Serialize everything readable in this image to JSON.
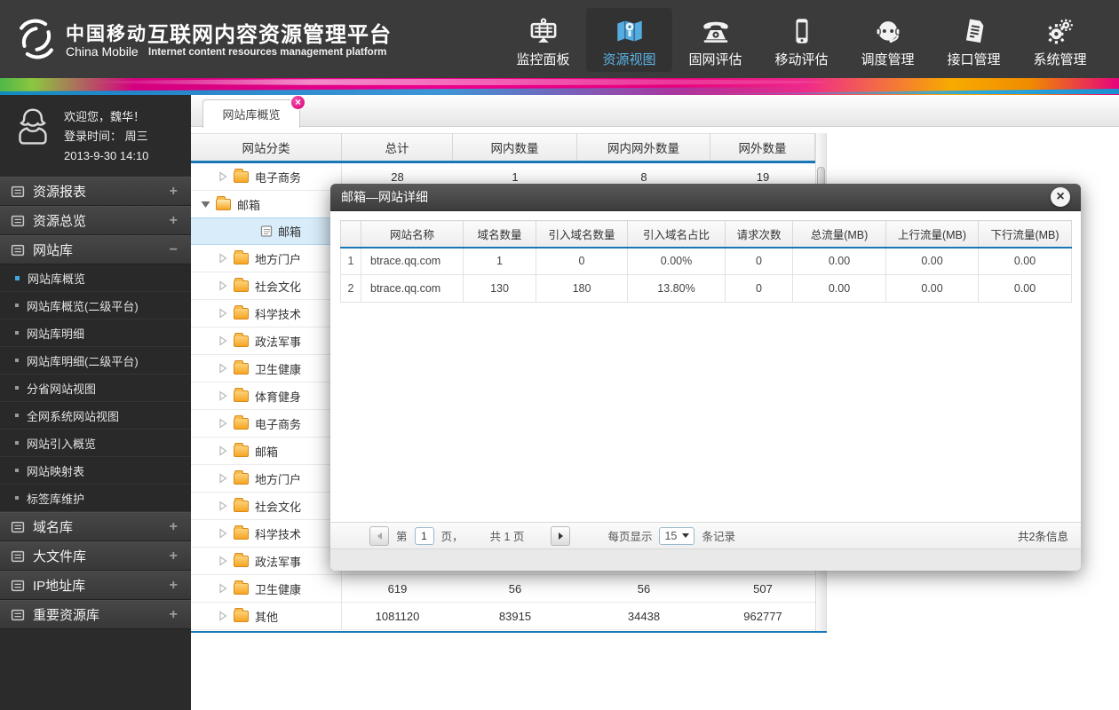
{
  "header": {
    "brand": {
      "cn": "中国移动",
      "en": "China Mobile"
    },
    "title_cn": "互联网内容资源管理平台",
    "title_en": "Internet content resources management platform",
    "nav": [
      {
        "label": "监控面板",
        "icon": "dashboard-icon",
        "active": false
      },
      {
        "label": "资源视图",
        "icon": "map-icon",
        "active": true
      },
      {
        "label": "固网评估",
        "icon": "phone-icon",
        "active": false
      },
      {
        "label": "移动评估",
        "icon": "mobile-icon",
        "active": false
      },
      {
        "label": "调度管理",
        "icon": "headset-icon",
        "active": false
      },
      {
        "label": "接口管理",
        "icon": "interface-doc-icon",
        "active": false
      },
      {
        "label": "系统管理",
        "icon": "gears-icon",
        "active": false
      }
    ],
    "accent_color": "#5db3e6"
  },
  "sidebar": {
    "user": {
      "welcome": "欢迎您，魏华！",
      "login_line": "登录时间： 周三",
      "login_time": "2013-9-30  14:10"
    },
    "menus": [
      {
        "label": "资源报表",
        "toggle": "+",
        "children": []
      },
      {
        "label": "资源总览",
        "toggle": "+",
        "children": []
      },
      {
        "label": "网站库",
        "toggle": "−",
        "children": [
          {
            "label": "网站库概览",
            "active": true
          },
          {
            "label": "网站库概览(二级平台)",
            "active": false
          },
          {
            "label": "网站库明细",
            "active": false
          },
          {
            "label": "网站库明细(二级平台)",
            "active": false
          },
          {
            "label": "分省网站视图",
            "active": false
          },
          {
            "label": "全网系统网站视图",
            "active": false
          },
          {
            "label": "网站引入概览",
            "active": false
          },
          {
            "label": "网站映射表",
            "active": false
          },
          {
            "label": "标签库维护",
            "active": false
          }
        ]
      },
      {
        "label": "域名库",
        "toggle": "+",
        "children": []
      },
      {
        "label": "大文件库",
        "toggle": "+",
        "children": []
      },
      {
        "label": "IP地址库",
        "toggle": "+",
        "children": []
      },
      {
        "label": "重要资源库",
        "toggle": "+",
        "children": []
      }
    ]
  },
  "tab": {
    "label": "网站库概览"
  },
  "main_table": {
    "columns": [
      "网站分类",
      "总计",
      "网内数量",
      "网内网外数量",
      "网外数量"
    ],
    "header_accent": "#1878b7",
    "rows": [
      {
        "label": "电子商务",
        "node": "collapsed",
        "selected": false,
        "values": [
          "28",
          "1",
          "8",
          "19"
        ]
      },
      {
        "label": "邮箱",
        "node": "expanded",
        "selected": false,
        "values": [
          "",
          "",
          "",
          ""
        ]
      },
      {
        "label": "邮箱",
        "node": "leaf",
        "selected": true,
        "values": [
          "",
          "",
          "",
          ""
        ]
      },
      {
        "label": "地方门户",
        "node": "collapsed",
        "selected": false,
        "values": [
          "",
          "",
          "",
          ""
        ]
      },
      {
        "label": "社会文化",
        "node": "collapsed",
        "selected": false,
        "values": [
          "",
          "",
          "",
          ""
        ]
      },
      {
        "label": "科学技术",
        "node": "collapsed",
        "selected": false,
        "values": [
          "",
          "",
          "",
          ""
        ]
      },
      {
        "label": "政法军事",
        "node": "collapsed",
        "selected": false,
        "values": [
          "",
          "",
          "",
          ""
        ]
      },
      {
        "label": "卫生健康",
        "node": "collapsed",
        "selected": false,
        "values": [
          "",
          "",
          "",
          ""
        ]
      },
      {
        "label": "体育健身",
        "node": "collapsed",
        "selected": false,
        "values": [
          "",
          "",
          "",
          ""
        ]
      },
      {
        "label": "电子商务",
        "node": "collapsed",
        "selected": false,
        "values": [
          "",
          "",
          "",
          ""
        ]
      },
      {
        "label": "邮箱",
        "node": "collapsed",
        "selected": false,
        "values": [
          "",
          "",
          "",
          ""
        ]
      },
      {
        "label": "地方门户",
        "node": "collapsed",
        "selected": false,
        "values": [
          "",
          "",
          "",
          ""
        ]
      },
      {
        "label": "社会文化",
        "node": "collapsed",
        "selected": false,
        "values": [
          "",
          "",
          "",
          ""
        ]
      },
      {
        "label": "科学技术",
        "node": "collapsed",
        "selected": false,
        "values": [
          "",
          "",
          "",
          ""
        ]
      },
      {
        "label": "政法军事",
        "node": "collapsed",
        "selected": false,
        "values": [
          "",
          "",
          "",
          ""
        ]
      },
      {
        "label": "卫生健康",
        "node": "collapsed",
        "selected": false,
        "values": [
          "619",
          "56",
          "56",
          "507"
        ]
      },
      {
        "label": "其他",
        "node": "collapsed",
        "selected": false,
        "values": [
          "1081120",
          "83915",
          "34438",
          "962777"
        ]
      }
    ]
  },
  "modal": {
    "title": "邮箱—网站详细",
    "table": {
      "columns": [
        "",
        "网站名称",
        "域名数量",
        "引入域名数量",
        "引入域名占比",
        "请求次数",
        "总流量(MB)",
        "上行流量(MB)",
        "下行流量(MB)"
      ],
      "rows": [
        [
          "1",
          "btrace.qq.com",
          "1",
          "0",
          "0.00%",
          "0",
          "0.00",
          "0.00",
          "0.00"
        ],
        [
          "2",
          "btrace.qq.com",
          "130",
          "180",
          "13.80%",
          "0",
          "0.00",
          "0.00",
          "0.00"
        ]
      ]
    },
    "pagination": {
      "page_prefix": "第",
      "page_value": "1",
      "page_mid": "页，",
      "pages_total": "共 1 页",
      "per_page_prefix": "每页显示",
      "per_page_value": "15",
      "per_page_suffix": "条记录",
      "total_info": "共2条信息"
    }
  }
}
